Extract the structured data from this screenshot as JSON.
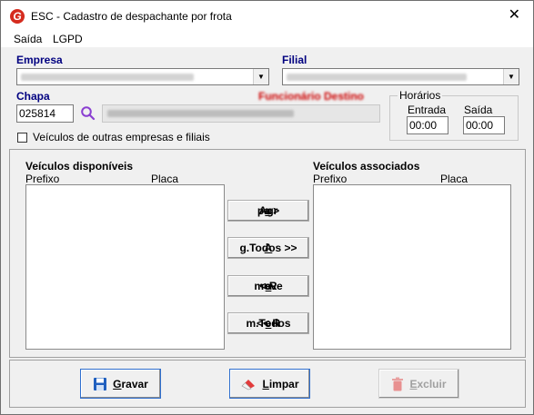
{
  "window": {
    "title": "ESC - Cadastro de despachante por frota",
    "close_glyph": "✕"
  },
  "menu": [
    {
      "label": "Saída"
    },
    {
      "label": "LGPD"
    }
  ],
  "empresa": {
    "label": "Empresa"
  },
  "filial": {
    "label": "Filial"
  },
  "chapa": {
    "label": "Chapa",
    "value": "025814"
  },
  "funcionario": {
    "label": "Funcionário Destino"
  },
  "horarios": {
    "title": "Horários",
    "entrada_label": "Entrada",
    "entrada_value": "00:00",
    "saida_label": "Saída",
    "saida_value": "00:00"
  },
  "checkbox": {
    "label": "Veículos de outras empresas e filiais"
  },
  "disponiveis": {
    "title": "Veículos disponíveis",
    "col_prefixo": "Prefixo",
    "col_placa": "Placa"
  },
  "associados": {
    "title": "Veículos associados",
    "col_prefixo": "Prefixo",
    "col_placa": "Placa"
  },
  "buttons": {
    "agrupa": {
      "pre": "Agr",
      "u": "u",
      "post": "pa >"
    },
    "ag_todos": {
      "pre": "",
      "u": "A",
      "post": "g.Todos >>"
    },
    "remove": {
      "pre": "< R",
      "u": "e",
      "post": "move"
    },
    "rem_todos": {
      "pre": "<< R",
      "u": "e",
      "post": "m.Todos"
    },
    "gravar": {
      "pre": "",
      "u": "G",
      "post": "ravar"
    },
    "limpar": {
      "pre": "",
      "u": "L",
      "post": "impar"
    },
    "excluir": {
      "pre": "",
      "u": "E",
      "post": "xcluir"
    }
  },
  "colors": {
    "label_blue": "#000080",
    "accent_red": "#d52b1e"
  },
  "icons": [
    "app-logo-icon",
    "close-icon",
    "dropdown-arrow-icon",
    "search-icon",
    "save-icon",
    "eraser-icon",
    "trash-icon"
  ]
}
